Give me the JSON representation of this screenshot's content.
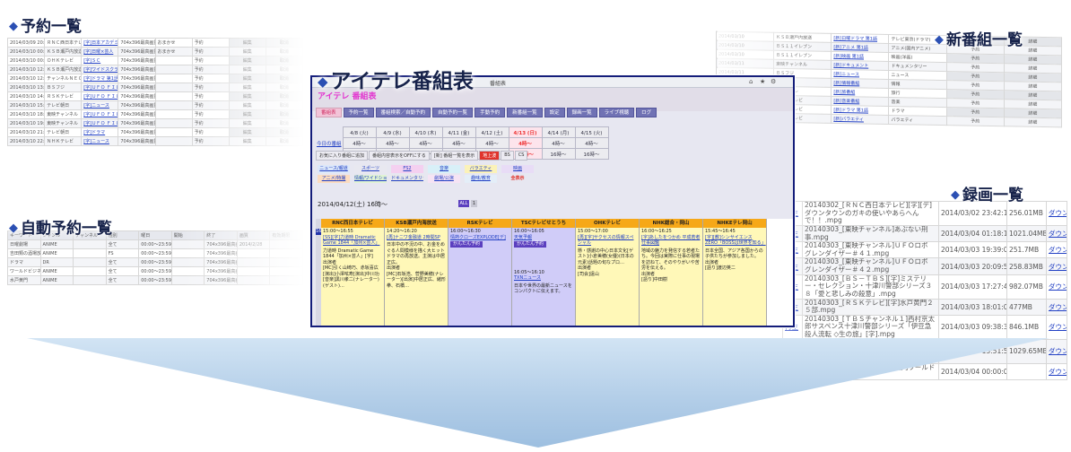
{
  "captions": {
    "reservation_list": "予約一覧",
    "auto_reservation_list": "自動予約一覧",
    "new_programs": "新番組一覧",
    "recordings": "録画一覧",
    "guide": "アイテレ番組表"
  },
  "colors": {
    "accent": "#141d7a",
    "nav": "#7072b4",
    "channel_header": "#f6a818",
    "caption": "#16224a"
  },
  "reservations": {
    "rows": [
      {
        "date": "2014/03/09 20:58〜23:28",
        "channel": "ＲＮＣ西日本テレビ",
        "title": "[字]日本アカデミー賞授賞式",
        "quality": "704x396最高画質(1.0Mbps)",
        "mode": "おまかせ",
        "status": "予約",
        "edit": "編集",
        "del": "取消"
      },
      {
        "date": "2014/03/10 00:25〜00:55",
        "channel": "ＫＳＢ瀬戸内放送",
        "title": "[字]日曜×芸人",
        "quality": "704x396最高画質(1.0Mbps)",
        "mode": "おまかせ",
        "status": "予約",
        "edit": "編集",
        "del": "取消"
      },
      {
        "date": "2014/03/10 00:25〜00:55",
        "channel": "ＯＨＫテレビ",
        "title": "[字]ＳＣ",
        "quality": "704x396最高画質(1.0Mbps)",
        "mode": "",
        "status": "予約",
        "edit": "編集",
        "del": "取消"
      },
      {
        "date": "2014/03/10 12:00〜13:00",
        "channel": "ＫＳＢ瀬戸内放送",
        "title": "[字]ワイドスクランブル",
        "quality": "704x396最高画質(1.0Mbps)",
        "mode": "",
        "status": "予約",
        "edit": "編集",
        "del": "取消"
      },
      {
        "date": "2014/03/10 12:00〜13:00",
        "channel": "チャンネルＮＥＣＯ",
        "title": "[字]ドラマ 第1話",
        "quality": "704x396最高画質(1.0Mbps)",
        "mode": "",
        "status": "予約",
        "edit": "編集",
        "del": "取消"
      },
      {
        "date": "2014/03/10 13:30〜14:00",
        "channel": "ＢＳフジ",
        "title": "[字]ＵＦＯ ＦＩＬＥ",
        "quality": "704x396最高画質(1.0Mbps)",
        "mode": "",
        "status": "予約",
        "edit": "編集",
        "del": "取消"
      },
      {
        "date": "2014/03/10 14:00〜15:00",
        "channel": "ＲＳＫテレビ",
        "title": "[字]ＵＦＯ ＦＩＬＥ グレンダイザー",
        "quality": "704x396最高画質(1.0Mbps)",
        "mode": "",
        "status": "予約",
        "edit": "編集",
        "del": "取消"
      },
      {
        "date": "2014/03/10 15:00〜18:00",
        "channel": "テレビ朝日",
        "title": "[字]ニュース",
        "quality": "704x396最高画質(1.0Mbps)",
        "mode": "",
        "status": "予約",
        "edit": "編集",
        "del": "取消"
      },
      {
        "date": "2014/03/10 18:00〜20:55",
        "channel": "東映チャンネル",
        "title": "[字]ＵＦＯ ＦＩＬＥ",
        "quality": "704x396最高画質(1.0Mbps)",
        "mode": "",
        "status": "予約",
        "edit": "編集",
        "del": "取消"
      },
      {
        "date": "2014/03/10 19:00〜20:55",
        "channel": "東映チャンネル",
        "title": "[字]ＵＦＯ ＦＩＬＥ",
        "quality": "704x396最高画質(1.0Mbps)",
        "mode": "",
        "status": "予約",
        "edit": "編集",
        "del": "取消"
      },
      {
        "date": "2014/03/10 21:00〜22:00",
        "channel": "テレビ朝日",
        "title": "[字]ドラマ",
        "quality": "704x396最高画質(1.0Mbps)",
        "mode": "",
        "status": "予約",
        "edit": "編集",
        "del": "取消"
      },
      {
        "date": "2014/03/10 22:00〜23:00",
        "channel": "ＮＨＫテレビ",
        "title": "[字]ニュース",
        "quality": "704x396最高画質(1.0Mbps)",
        "mode": "",
        "status": "予約",
        "edit": "編集",
        "del": "取消"
      }
    ]
  },
  "auto_reservations": {
    "headers": [
      "キーワード",
      "ジャンル",
      "チャンネル",
      "種別",
      "曜日",
      "開始",
      "終了",
      "画質",
      "有効期限"
    ],
    "rows": [
      [
        "日曜劇場",
        "ANIME",
        "",
        "全て",
        "00:00〜23:59",
        "",
        "704x396最高画質(1.0Mbps)",
        "2014/2/28",
        ""
      ],
      [
        "吉田類の酒場放浪記",
        "ANIME",
        "",
        "FS",
        "00:00〜23:59",
        "",
        "704x396最高画質(1.0Mbps)",
        "",
        ""
      ],
      [
        "ドラマ",
        "DR",
        "",
        "全て",
        "00:00〜23:59",
        "",
        "704x396最高画質(1.0Mbps)",
        "",
        ""
      ],
      [
        "ワールドビジネス",
        "ANIME",
        "",
        "全て",
        "00:00〜23:59",
        "",
        "704x396最高画質(1.0Mbps)",
        "",
        ""
      ],
      [
        "水戸黄門",
        "ANIME",
        "",
        "全て",
        "00:00〜23:59",
        "",
        "704x396最高画質(1.0Mbps)",
        "",
        ""
      ]
    ]
  },
  "new_programs": {
    "rows": [
      [
        "2014/03/10",
        "ＫＳＢ瀬戸内放送",
        "[新]日曜ドラマ 第1話",
        "テレビ東京(ドラマ)",
        "予約",
        "詳細"
      ],
      [
        "2014/03/10",
        "ＢＳ１１イレブン",
        "[新]アニメ 第1話",
        "アニメ(国内アニメ)",
        "予約",
        "詳細"
      ],
      [
        "2014/03/10",
        "ＢＳ１１イレブン",
        "[新]映画 第1話",
        "映画(洋画)",
        "予約",
        "詳細"
      ],
      [
        "2014/03/11",
        "東映チャンネル",
        "[新]ドキュメント",
        "ドキュメンタリー",
        "予約",
        "詳細"
      ],
      [
        "2014/03/11",
        "ＢＳフジ",
        "[新]ニュース",
        "ニュース",
        "予約",
        "詳細"
      ],
      [
        "2014/03/11",
        "ＢＳフジ",
        "[新]情報番組",
        "情報",
        "予約",
        "詳細"
      ],
      [
        "2014/03/12",
        "ＢＳ日テレ",
        "[新]旅番組",
        "旅行",
        "予約",
        "詳細"
      ],
      [
        "2014/03/12",
        "ＲＳＫテレビ",
        "[新]音楽番組",
        "音楽",
        "予約",
        "詳細"
      ],
      [
        "2014/03/12",
        "ＯＨＫテレビ",
        "[新]ドラマ 第1話",
        "ドラマ",
        "予約",
        "詳細"
      ],
      [
        "2014/03/13",
        "ＲＳＫテレビ",
        "[新]バラエティ",
        "バラエティ",
        "予約",
        "詳細"
      ]
    ]
  },
  "recordings": {
    "rows": [
      {
        "action": "再生",
        "file": "20140302_[ＲＮＣ西日本テレビ][字][デ]ダウンタウンのガキの使いやあらへんで！！.mpg",
        "date": "2014/03/02 23:42:10",
        "size": "256.01MB",
        "dl": "ダウンロード"
      },
      {
        "action": "再生",
        "file": "20140303_[東映チャンネル]あぶない刑事.mpg",
        "date": "2014/03/04 01:18:14",
        "size": "1021.04MB",
        "dl": "ダウンロード"
      },
      {
        "action": "再生",
        "file": "20140303_[東映チャンネル]ＵＦＯロボ グレンダイザー＃４１.mpg",
        "date": "2014/03/03 19:39:08",
        "size": "251.7MB",
        "dl": "ダウンロード"
      },
      {
        "action": "再生",
        "file": "20140303_[東映チャンネル]ＵＦＯロボ グレンダイザー＃４２.mpg",
        "date": "2014/03/03 20:09:52",
        "size": "258.83MB",
        "dl": "ダウンロード"
      },
      {
        "action": "再生",
        "file": "20140303_[ＢＳ－ＴＢＳ][字]ミステリー・セレクション・十津川警部シリーズ３８「愛と悲しみの殺意」.mpg",
        "date": "2014/03/03 17:27:49",
        "size": "982.07MB",
        "dl": "ダウンロード"
      },
      {
        "action": "再生",
        "file": "20140303_[ＲＳＫテレビ][字]水戸黄門２５部.mpg",
        "date": "2014/03/03 18:01:00",
        "size": "477MB",
        "dl": "ダウンロード"
      },
      {
        "action": "再生",
        "file": "20140303_[ＴＢＳチャンネル１]西村京太郎サスペンス十津川警部シリーズ「伊豆急殺人流転 ◇生の旅」[字].mpg",
        "date": "2014/03/03 09:38:30",
        "size": "846.1MB",
        "dl": "ダウンロード"
      },
      {
        "action": "再生",
        "file": "20140303_[ＴＢＳチャンネル２]西村京太郎サスペンス十津川警部シリーズ「愛知特急伝伊豆人行」.mpg",
        "date": "2014/03/03 13:51:50",
        "size": "1029.65MB",
        "dl": "ダウンロード"
      },
      {
        "action": "再生",
        "file": "20140304_[ＢＳテレビ]水戸黄門ワールドプレミア.mpg",
        "date": "2014/03/04 00:00:00",
        "size": "",
        "dl": "ダウンロード"
      }
    ]
  },
  "window": {
    "title": "アイテレ番組表",
    "title_short": "番組表",
    "subtitle": "アイテレ 番組表",
    "nav": [
      {
        "label": "番組表",
        "active": true
      },
      {
        "label": "予約一覧",
        "active": false
      },
      {
        "label": "番組検索／自動予約",
        "active": false
      },
      {
        "label": "自動予約一覧",
        "active": false
      },
      {
        "label": "手動予約",
        "active": false
      },
      {
        "label": "新番組一覧",
        "active": false
      },
      {
        "label": "設定",
        "active": false
      },
      {
        "label": "録画一覧",
        "active": false
      },
      {
        "label": "ライブ視聴",
        "active": false
      },
      {
        "label": "ログ",
        "active": false
      }
    ],
    "today_link": "今日の番組",
    "days": [
      {
        "date": "4/8 (火)",
        "h1": "4時〜",
        "h2": "16時〜",
        "today": false
      },
      {
        "date": "4/9 (水)",
        "h1": "4時〜",
        "h2": "16時〜",
        "today": false
      },
      {
        "date": "4/10 (木)",
        "h1": "4時〜",
        "h2": "16時〜",
        "today": false
      },
      {
        "date": "4/11 (金)",
        "h1": "4時〜",
        "h2": "16時〜",
        "today": false
      },
      {
        "date": "4/12 (土)",
        "h1": "4時〜",
        "h2": "16時〜",
        "today": false
      },
      {
        "date": "4/13 (日)",
        "h1": "4時〜",
        "h2": "16時〜",
        "today": true
      },
      {
        "date": "4/14 (月)",
        "h1": "4時〜",
        "h2": "16時〜",
        "today": false
      },
      {
        "date": "4/15 (火)",
        "h1": "4時〜",
        "h2": "16時〜",
        "today": false
      }
    ],
    "misc": [
      "お気に入り番組に追加",
      "番組内容表示をOFFにする",
      "[新] 番組一覧を表示",
      "地上波",
      "BS",
      "CS"
    ],
    "genres": [
      {
        "label": "ニュース/報道",
        "bg": "#dce8fa"
      },
      {
        "label": "スポーツ",
        "bg": "#e8e8f0"
      },
      {
        "label": "FS2",
        "bg": "#f4d0f0"
      },
      {
        "label": "音楽",
        "bg": "#d8f0f8"
      },
      {
        "label": "バラエティ",
        "bg": "#fbf2b8"
      },
      {
        "label": "映画",
        "bg": "#e8dcf6"
      },
      {
        "label": "",
        "bg": "transparent"
      },
      {
        "label": "アニメ/特撮",
        "bg": "#fcdcc0"
      },
      {
        "label": "情報/ワイドショー",
        "bg": "#e0f4d4"
      },
      {
        "label": "ドキュメンタリー/教養",
        "bg": "#e8e8e8"
      },
      {
        "label": "劇場/公演",
        "bg": "#f6e4f4"
      },
      {
        "label": "趣味/教育",
        "bg": "#e4eef8"
      },
      {
        "label": "全表示",
        "bg": "transparent"
      },
      {
        "label": "",
        "bg": "transparent"
      }
    ],
    "timeline": "2014/04/12(土) 16時〜",
    "hour_btn_all": "ALL",
    "hour_btn_2": "1",
    "hour_label": "16",
    "channels": [
      {
        "name": "RNC西日本テレビ",
        "programs": [
          {
            "time": "15:00〜16:55",
            "title": "[SS][字]力道時 Dramatic Game 1844「加州×芸人」",
            "desc": "力道時 Dramatic Game 1844「加州×芸人」[字]\n出演者\n[MC]引く山崎巧、赤坂喜広[演出]小澤呟寿[演出]中川功[音楽]黒川孝二(ナレーター)(ゲスト)…",
            "bg": "#fff8b8",
            "badge": ""
          }
        ]
      },
      {
        "name": "KSB瀬戸内海放送",
        "programs": [
          {
            "time": "14:20〜16:20",
            "title": "[再]ナニワ金融道 2時間SP",
            "desc": "日本中の不況の中、お金をめぐる人間模様を描く大ヒットドラマの再放送。主演は中居正広。\n出演者\n[MC]石坂浩、菅野美穂(ナレーター)[出演]中居正広、緒形拳、石橋…",
            "bg": "#fff8b8",
            "badge": ""
          }
        ]
      },
      {
        "name": "RSKテレビ",
        "programs": [
          {
            "time": "16:00〜16:30",
            "title": "情熱クローズEXPLODE[デ]",
            "desc": "",
            "bg": "#d0ccf8",
            "badge": "かんたん予約"
          }
        ]
      },
      {
        "name": "TSCテレビせとうち",
        "programs": [
          {
            "time": "16:00〜16:05",
            "title": "天気予報",
            "desc": "",
            "bg": "#d0ccf8",
            "badge": "かんたん予約"
          },
          {
            "time": "16:05〜16:10",
            "title": "TXNニュース",
            "desc": "日本や世界の最新ニュースをコンパクトに伝えます。",
            "bg": "#d0ccf8",
            "badge": ""
          }
        ]
      },
      {
        "name": "OHKテレビ",
        "programs": [
          {
            "time": "15:00〜17:00",
            "title": "[再][字]サクセスの情報スペシャル",
            "desc": "懸・感謝の中心日本文化[ゲスト]小倉美穂(女優)(日本の元素)話題の旬なプロ…\n出演者\n[司会]遠山",
            "bg": "#fff8b8",
            "badge": ""
          }
        ]
      },
      {
        "name": "NHK総合・岡山",
        "programs": [
          {
            "time": "16:00〜16:25",
            "title": "[字]あしたをつかめ 平成若者仕事図鑑",
            "desc": "地域の魅力を発信する若者たち。今回は実際に仕事の現場を訪ねて、そのやりがいや苦労を伝える。\n出演者\n[語り]中田樹",
            "bg": "#fff8b8",
            "badge": ""
          }
        ]
      },
      {
        "name": "NHKEテレ岡山",
        "programs": [
          {
            "time": "15:45〜16:45",
            "title": "[字][教]シンサイエンス ZERO「BOSSは世界を知る」",
            "desc": "日本全国、アジア各国からの子供たちが参加しました。\n出演者\n[語り]渡辺英二",
            "bg": "#fff8b8",
            "badge": ""
          }
        ]
      }
    ]
  }
}
